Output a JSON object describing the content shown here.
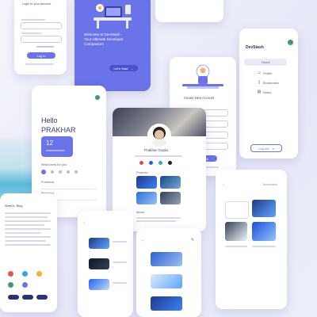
{
  "theme": {
    "background": "#eceefa",
    "accent": "#6a73e8",
    "accent_dark": "#4b51c9",
    "card": "#ffffff",
    "muted": "#8a8fae",
    "tile_blue": "#2f5fd0"
  },
  "login_screen": {
    "title": "Login to your account",
    "button_label": "Log in"
  },
  "welcome_screen": {
    "heading_line1": "Welcome to DevStash -",
    "heading_line2": "Your Ultimate Developer",
    "heading_line3": "Companion!",
    "cta_label": "Let's Start"
  },
  "signup_screen": {
    "title": "Create New Account",
    "button_label": "Sign Up"
  },
  "menu_screen": {
    "app_name": "DevStash",
    "items": [
      {
        "label": "Home",
        "icon": "home-icon"
      },
      {
        "label": "Profile",
        "icon": "user-icon"
      },
      {
        "label": "Bookmarks",
        "icon": "bookmark-icon"
      },
      {
        "label": "Notes",
        "icon": "note-icon"
      }
    ],
    "logout_label": "Log out"
  },
  "home_screen": {
    "greeting": "Hello",
    "user_name": "PRAKHAR",
    "stat_value": "12",
    "section_title": "Resources for you",
    "categories": [
      "Frontend",
      "Backend",
      "Android"
    ]
  },
  "profile_screen": {
    "user_name": "Prakhar Gupta",
    "section_label": "Projects",
    "about_label": "About"
  },
  "bookmarks_screen": {
    "title": "Bookmarks"
  },
  "article_screen": {
    "heading": "WebGL Blog"
  }
}
